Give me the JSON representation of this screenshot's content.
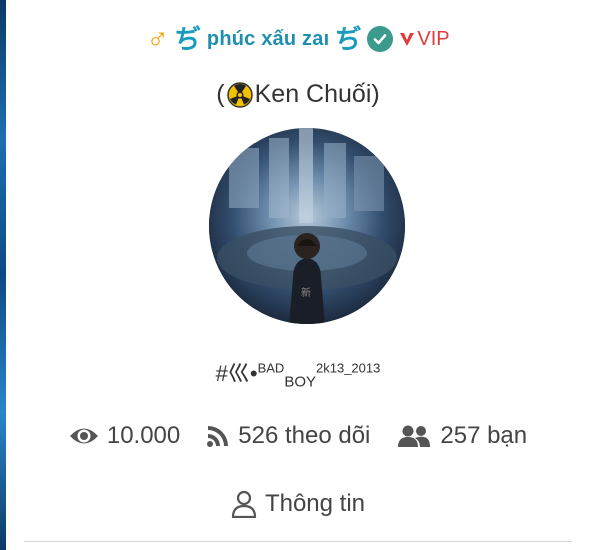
{
  "profile": {
    "display_name": "phúc xấu zaı",
    "nickname": "Ken Chuối",
    "vip_label": "VIP",
    "tagline_main": "#巛•",
    "tagline_sup1": "BAD",
    "tagline_sub1": "BOY",
    "tagline_sup2": "2k13",
    "tagline_sub2": "_2013",
    "icons": [
      "male-icon",
      "deco-icon",
      "verified-icon",
      "vip-icon",
      "radioactive-icon"
    ]
  },
  "stats": {
    "views": "10.000",
    "followers": "526 theo dõi",
    "friends": "257 bạn"
  },
  "tabs": {
    "info_label": "Thông tin"
  },
  "colors": {
    "name": "#1f8fb0",
    "male": "#f2a400",
    "verified": "#3b9a8c",
    "vip": "#e23b3b",
    "text": "#444444"
  }
}
